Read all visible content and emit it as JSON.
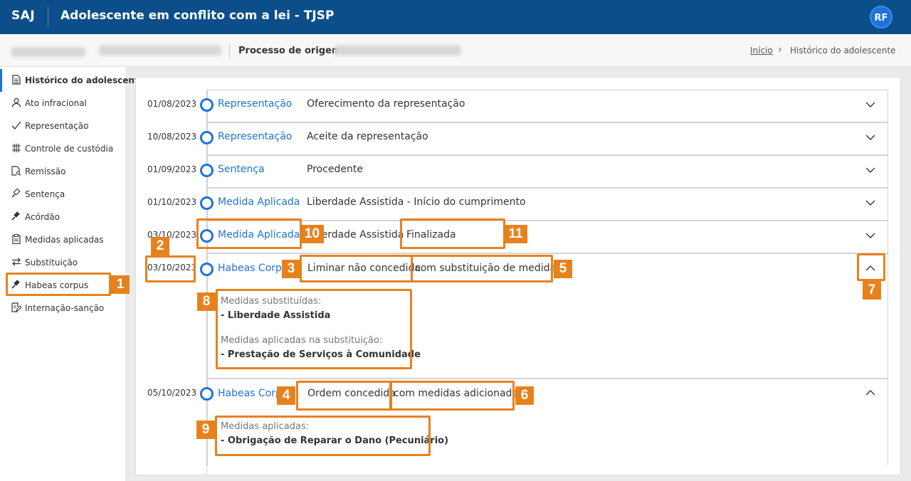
{
  "header": {
    "brand": "SAJ",
    "title": "Adolescente em conflito com a lei - TJSP",
    "user_initials": "RF"
  },
  "subbar": {
    "origin_label": "Processo de origem:",
    "breadcrumb": {
      "home": "Início",
      "current": "Histórico do adolescente"
    }
  },
  "sidebar": {
    "items": [
      {
        "label": "Histórico do adolescente",
        "icon": "document-icon"
      },
      {
        "label": "Ato infracional",
        "icon": "person-icon"
      },
      {
        "label": "Representação",
        "icon": "check-icon"
      },
      {
        "label": "Controle de custódia",
        "icon": "hash-grid-icon"
      },
      {
        "label": "Remissão",
        "icon": "document-search-icon"
      },
      {
        "label": "Sentença",
        "icon": "gavel-icon"
      },
      {
        "label": "Acórdão",
        "icon": "gavel-filled-icon"
      },
      {
        "label": "Medidas aplicadas",
        "icon": "clipboard-icon"
      },
      {
        "label": "Substituição",
        "icon": "swap-arrows-icon"
      },
      {
        "label": "Habeas corpus",
        "icon": "gavel-filled-icon"
      },
      {
        "label": "Internação-sanção",
        "icon": "document-edit-icon"
      }
    ]
  },
  "timeline": {
    "rows": [
      {
        "date": "01/08/2023",
        "type": "Representação",
        "desc": "Oferecimento da representação"
      },
      {
        "date": "10/08/2023",
        "type": "Representação",
        "desc": "Aceite da representação"
      },
      {
        "date": "01/09/2023",
        "type": "Sentença",
        "desc": "Procedente"
      },
      {
        "date": "01/10/2023",
        "type": "Medida Aplicada",
        "desc": "Liberdade Assistida - Início do cumprimento"
      },
      {
        "date": "03/10/2023",
        "type": "Medida Aplicada",
        "desc": "Liberdade Assistida",
        "status": "Finalizada"
      },
      {
        "date": "03/10/2023",
        "type": "Habeas Corpus",
        "desc": "Liminar não concedida",
        "desc_extra": "com substituição de medidas",
        "details": [
          {
            "label": "Medidas substituídas:",
            "value": "- Liberdade Assistida"
          },
          {
            "label": "Medidas aplicadas na substituição:",
            "value": "- Prestação de Serviços à Comunidade"
          }
        ]
      },
      {
        "date": "05/10/2023",
        "type": "Habeas Corpus",
        "desc": "Ordem concedida",
        "desc_extra": "com medidas adicionadas",
        "details": [
          {
            "label": "Medidas aplicadas:",
            "value": "- Obrigação de Reparar o Dano (Pecuniário)"
          }
        ]
      }
    ]
  },
  "callouts": [
    "1",
    "2",
    "3",
    "4",
    "5",
    "6",
    "7",
    "8",
    "9",
    "10",
    "11"
  ],
  "colors": {
    "header_bg": "#0c4e8a",
    "link": "#1e73d8",
    "callout": "#e6821e"
  }
}
